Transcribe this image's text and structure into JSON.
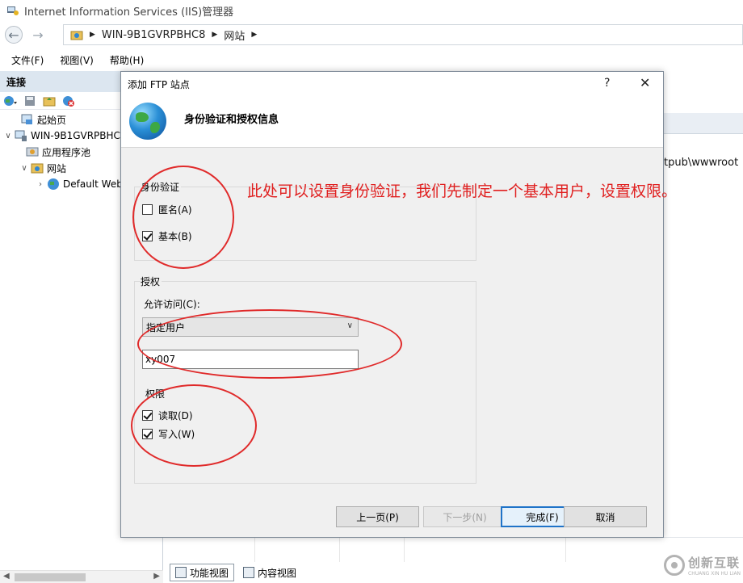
{
  "window": {
    "title": "Internet Information Services (IIS)管理器"
  },
  "address_bar": {
    "crumbs": [
      "WIN-9B1GVRPBHC8",
      "网站"
    ]
  },
  "menu": [
    "文件(F)",
    "视图(V)",
    "帮助(H)"
  ],
  "left_panel": {
    "header": "连接",
    "tree": [
      {
        "label": "起始页",
        "icon": "start-page-icon"
      },
      {
        "label": "WIN-9B1GVRPBHC8",
        "icon": "server-icon"
      },
      {
        "label": "应用程序池",
        "icon": "app-pool-icon"
      },
      {
        "label": "网站",
        "icon": "sites-folder-icon"
      },
      {
        "label": "Default Web",
        "icon": "globe-icon"
      }
    ]
  },
  "right_panel": {
    "path_fragment": "tpub\\wwwroot",
    "bottom_tabs": [
      "功能视图",
      "内容视图"
    ]
  },
  "dialog": {
    "title": "添加 FTP 站点",
    "help": "?",
    "close": "✕",
    "heading": "身份验证和授权信息",
    "auth_group": {
      "label": "身份验证",
      "options": [
        {
          "label": "匿名(A)",
          "checked": false
        },
        {
          "label": "基本(B)",
          "checked": true
        }
      ]
    },
    "authorization_group": {
      "label": "授权",
      "allow_access_label": "允许访问(C):",
      "allow_access_value": "指定用户",
      "user_value": "xy007",
      "permissions_label": "权限",
      "permissions": [
        {
          "label": "读取(D)",
          "checked": true
        },
        {
          "label": "写入(W)",
          "checked": true
        }
      ]
    },
    "buttons": {
      "prev": "上一页(P)",
      "next": "下一步(N)",
      "finish": "完成(F)",
      "cancel": "取消"
    }
  },
  "annotation": {
    "text": "此处可以设置身份验证，我们先制定一个基本用户，设置权限。",
    "color": "#e02020"
  },
  "watermark": {
    "title": "创新互联",
    "subtitle": "CHUANG XIN HU LIAN"
  }
}
